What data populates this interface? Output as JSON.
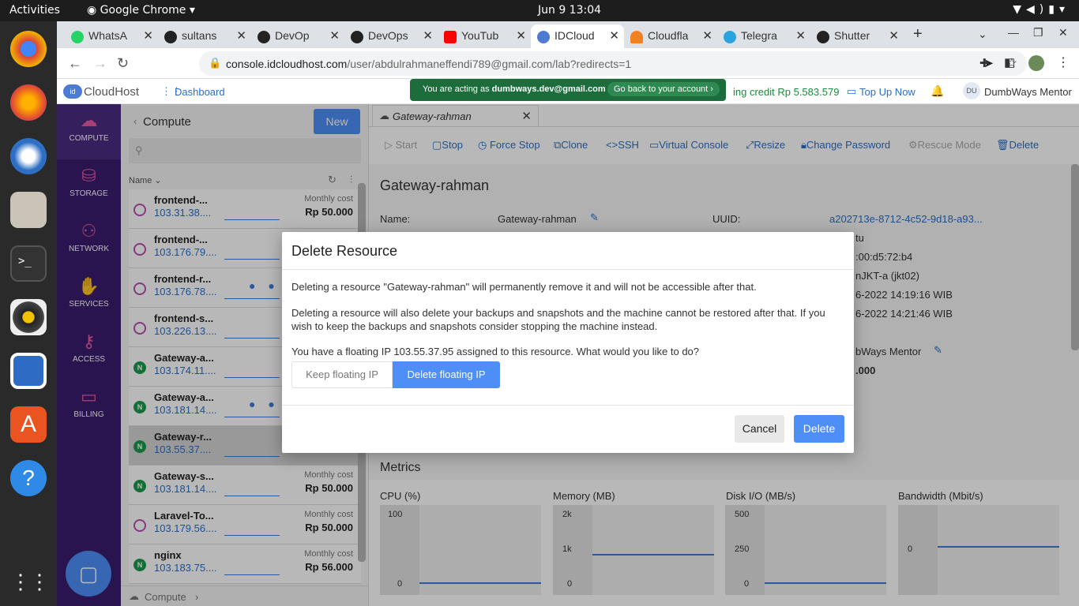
{
  "os": {
    "activities": "Activities",
    "app_name": "Google Chrome",
    "clock": "Jun 9  13:04"
  },
  "browser": {
    "tabs": [
      {
        "label": "WhatsA",
        "color": "#25d366"
      },
      {
        "label": "sultans",
        "color": "#222222"
      },
      {
        "label": "DevOp",
        "color": "#222222"
      },
      {
        "label": "DevOps",
        "color": "#222222"
      },
      {
        "label": "YouTub",
        "color": "#ff0000"
      },
      {
        "label": "IDCloud",
        "color": "#4d7bd4"
      },
      {
        "label": "Cloudfla",
        "color": "#f48120"
      },
      {
        "label": "Telegra",
        "color": "#2aa3df"
      },
      {
        "label": "Shutter",
        "color": "#222222"
      }
    ],
    "url_main": "console.idcloudhost.com",
    "url_path": "/user/abdulrahmaneffendi789@gmail.com/lab?redirects=1"
  },
  "header": {
    "logo": "CloudHost",
    "dashboard": "Dashboard",
    "banner_text": "You are acting as ",
    "banner_email": "dumbways.dev@gmail.com",
    "banner_back": "Go back to your account ›",
    "credit": "ing credit Rp 5.583.579",
    "top_up": "Top Up Now",
    "user_initials": "DU",
    "user_name": "DumbWays Mentor"
  },
  "sidebar": {
    "items": [
      {
        "label": "COMPUTE"
      },
      {
        "label": "STORAGE"
      },
      {
        "label": "NETWORK"
      },
      {
        "label": "SERVICES"
      },
      {
        "label": "ACCESS"
      },
      {
        "label": "BILLING"
      }
    ]
  },
  "list": {
    "title": "Compute",
    "new_button": "New",
    "sort_label": "Name",
    "footer": "Compute",
    "items": [
      {
        "name": "frontend-...",
        "ip": "103.31.38....",
        "cost_label": "Monthly cost",
        "price": "Rp 50.000",
        "os": "ubuntu"
      },
      {
        "name": "frontend-...",
        "ip": "103.176.79....",
        "cost_label": "",
        "price": "",
        "os": "ubuntu"
      },
      {
        "name": "frontend-r...",
        "ip": "103.176.78....",
        "cost_label": "",
        "price": "",
        "os": "ubuntu"
      },
      {
        "name": "frontend-s...",
        "ip": "103.226.13....",
        "cost_label": "",
        "price": "",
        "os": "ubuntu"
      },
      {
        "name": "Gateway-a...",
        "ip": "103.174.11....",
        "cost_label": "",
        "price": "",
        "os": "nginx"
      },
      {
        "name": "Gateway-a...",
        "ip": "103.181.14....",
        "cost_label": "",
        "price": "",
        "os": "nginx"
      },
      {
        "name": "Gateway-r...",
        "ip": "103.55.37....",
        "cost_label": "",
        "price": "",
        "os": "nginx"
      },
      {
        "name": "Gateway-s...",
        "ip": "103.181.14....",
        "cost_label": "Monthly cost",
        "price": "Rp 50.000",
        "os": "nginx"
      },
      {
        "name": "Laravel-To...",
        "ip": "103.179.56....",
        "cost_label": "Monthly cost",
        "price": "Rp 50.000",
        "os": "ubuntu"
      },
      {
        "name": "nginx",
        "ip": "103.183.75....",
        "cost_label": "Monthly cost",
        "price": "Rp 56.000",
        "os": "nginx"
      }
    ]
  },
  "detail": {
    "tab_title": "Gateway-rahman",
    "toolbar": {
      "start": "Start",
      "stop": "Stop",
      "force_stop": "Force Stop",
      "clone": "Clone",
      "ssh": "SSH",
      "console": "Virtual Console",
      "resize": "Resize",
      "change_password": "Change Password",
      "rescue": "Rescue Mode",
      "delete": "Delete"
    },
    "heading": "Gateway-rahman",
    "name_label": "Name:",
    "name_value": "Gateway-rahman",
    "uuid_label": "UUID:",
    "uuid_value": "a202713e-8712-4c52-9d18-a93...",
    "partial_values": [
      "tu",
      ":00:d5:72:b4",
      "nJKT-a (jkt02)",
      "6-2022 14:19:16 WIB",
      "6-2022 14:21:46 WIB",
      "bWays Mentor",
      ".000"
    ],
    "metrics_title": "Metrics",
    "metrics": [
      {
        "label": "CPU (%)",
        "ticks": [
          "100",
          "0"
        ]
      },
      {
        "label": "Memory (MB)",
        "ticks": [
          "2k",
          "1k",
          "0"
        ]
      },
      {
        "label": "Disk I/O (MB/s)",
        "ticks": [
          "500",
          "250",
          "0"
        ]
      },
      {
        "label": "Bandwidth (Mbit/s)",
        "ticks": [
          "0"
        ]
      }
    ]
  },
  "modal": {
    "title": "Delete Resource",
    "p1": "Deleting a resource \"Gateway-rahman\" will permanently remove it and will not be accessible after that.",
    "p2": "Deleting a resource will also delete your backups and snapshots and the machine cannot be restored after that. If you wish to keep the backups and snapshots consider stopping the machine instead.",
    "p3": "You have a floating IP 103.55.37.95 assigned to this resource. What would you like to do?",
    "keep_ip": "Keep floating IP",
    "delete_ip": "Delete floating IP",
    "cancel": "Cancel",
    "delete": "Delete"
  },
  "colors": {
    "accent": "#4d8ef7",
    "sidebar": "#3a1d6e",
    "link": "#2a6fc9",
    "banner": "#1d6d3c"
  }
}
